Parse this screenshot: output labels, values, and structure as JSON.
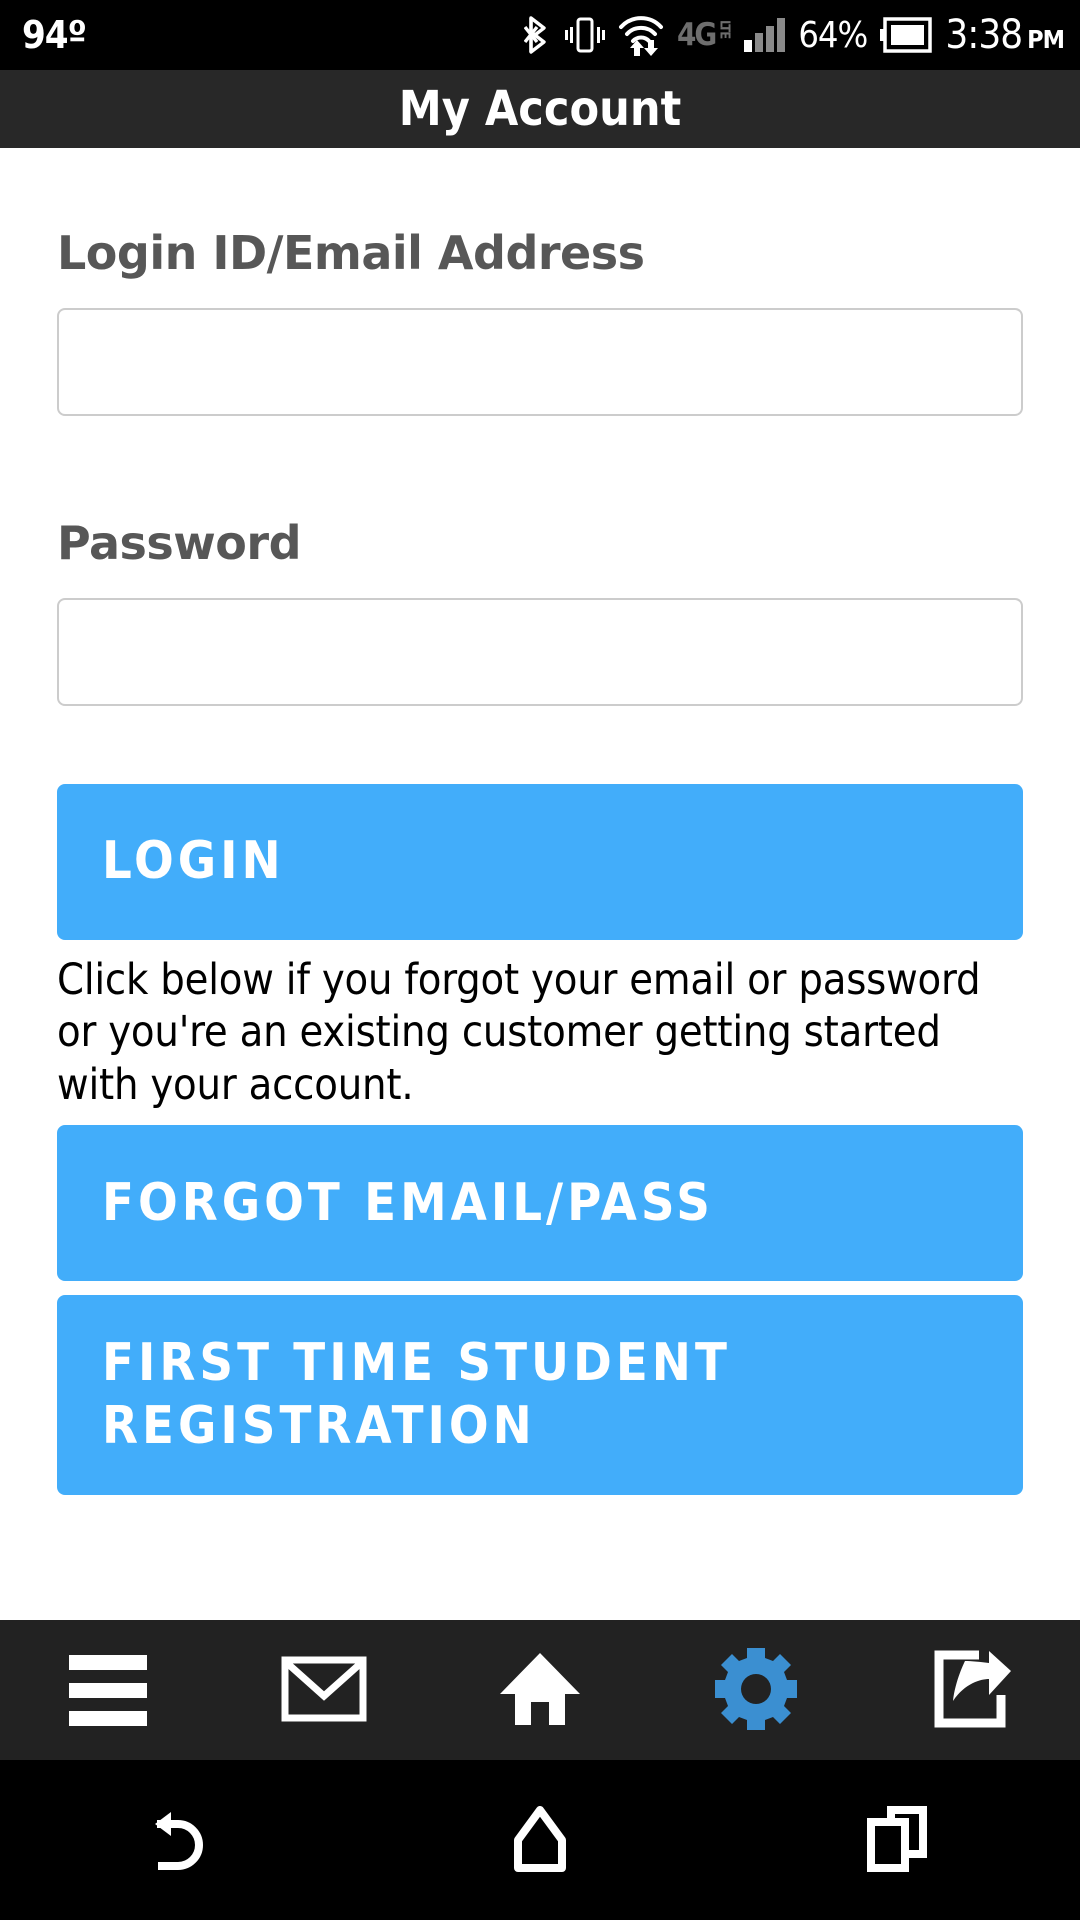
{
  "status_bar": {
    "temperature": "94º",
    "network_type": "4G",
    "network_type_sub": "LTE",
    "battery_percent": "64%",
    "time": "3:38",
    "meridiem": "PM",
    "icons": [
      "bluetooth-icon",
      "vibrate-icon",
      "wifi-data-icon",
      "signal-bars-icon",
      "battery-icon"
    ]
  },
  "header": {
    "title": "My Account"
  },
  "form": {
    "login_label": "Login ID/Email Address",
    "login_value": "",
    "login_placeholder": "",
    "password_label": "Password",
    "password_value": "",
    "password_placeholder": "",
    "login_button": "LOGIN",
    "help_text": "Click below if you forgot your email or password or you're an existing customer getting started with your account.",
    "forgot_button": "FORGOT EMAIL/PASS",
    "register_button": "FIRST TIME STUDENT REGISTRATION"
  },
  "toolbar": {
    "items": [
      {
        "name": "menu-icon",
        "label": "Menu",
        "active": false
      },
      {
        "name": "envelope-icon",
        "label": "Messages",
        "active": false
      },
      {
        "name": "home-icon",
        "label": "Home",
        "active": false
      },
      {
        "name": "gear-icon",
        "label": "Settings",
        "active": true
      },
      {
        "name": "share-icon",
        "label": "Share",
        "active": false
      }
    ]
  },
  "nav_bar": {
    "items": [
      {
        "name": "back-icon",
        "label": "Back"
      },
      {
        "name": "home-icon",
        "label": "Home"
      },
      {
        "name": "recents-icon",
        "label": "Recents"
      }
    ]
  },
  "colors": {
    "accent_blue": "#42adfa",
    "gear_blue": "#3b8fd1",
    "title_bar": "#282828",
    "toolbar": "#222222",
    "status_bar": "#000000",
    "label_gray": "#575757",
    "input_border": "#cccccc"
  }
}
